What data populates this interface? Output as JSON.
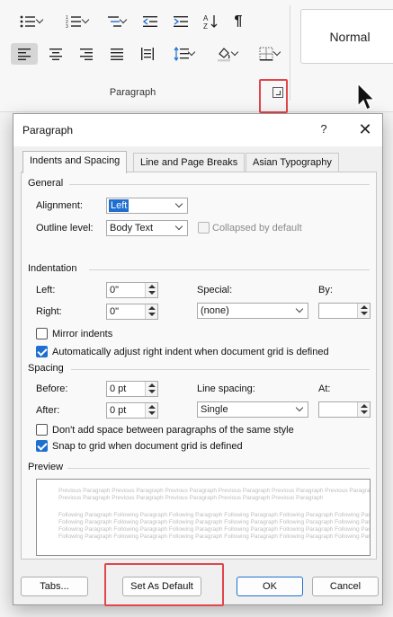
{
  "ribbon": {
    "group_label": "Paragraph",
    "style_name": "Normal",
    "icons_row1": [
      "bullets-icon",
      "numbering-icon",
      "multilevel-list-icon",
      "decrease-indent-icon",
      "increase-indent-icon",
      "sort-icon",
      "pilcrow-icon"
    ],
    "icons_row2": [
      "align-left-icon",
      "center-icon",
      "align-right-icon",
      "justify-icon",
      "column-distribute-icon",
      "line-spacing-icon",
      "shading-icon",
      "borders-icon"
    ],
    "accent_highlight": "#e0464b"
  },
  "dialog": {
    "title": "Paragraph",
    "help": "?",
    "close": "✕",
    "tabs": [
      "Indents and Spacing",
      "Line and Page Breaks",
      "Asian Typography"
    ],
    "active_tab": "Indents and Spacing",
    "general": {
      "heading": "General",
      "alignment_label": "Alignment:",
      "alignment_value": "Left",
      "outline_label": "Outline level:",
      "outline_value": "Body Text",
      "collapsed_label": "Collapsed by default"
    },
    "indentation": {
      "heading": "Indentation",
      "left_label": "Left:",
      "left_value": "0\"",
      "right_label": "Right:",
      "right_value": "0\"",
      "special_label": "Special:",
      "special_value": "(none)",
      "by_label": "By:",
      "by_value": "",
      "mirror_label": "Mirror indents",
      "mirror_checked": false,
      "auto_adjust_label": "Automatically adjust right indent when document grid is defined",
      "auto_adjust_checked": true
    },
    "spacing": {
      "heading": "Spacing",
      "before_label": "Before:",
      "before_value": "0 pt",
      "after_label": "After:",
      "after_value": "0 pt",
      "line_spacing_label": "Line spacing:",
      "line_spacing_value": "Single",
      "at_label": "At:",
      "at_value": "",
      "dont_add_label": "Don't add space between paragraphs of the same style",
      "dont_add_checked": false,
      "snap_label": "Snap to grid when document grid is defined",
      "snap_checked": true
    },
    "preview": {
      "heading": "Preview",
      "lines": [
        "Previous Paragraph Previous Paragraph Previous Paragraph Previous Paragraph Previous Paragraph Previous Paragraph",
        "Previous Paragraph Previous Paragraph Previous Paragraph Previous Paragraph Previous Paragraph",
        "Following Paragraph Following Paragraph Following Paragraph Following Paragraph Following Paragraph Following Paragraph",
        "Following Paragraph Following Paragraph Following Paragraph Following Paragraph Following Paragraph Following Paragraph",
        "Following Paragraph Following Paragraph Following Paragraph Following Paragraph Following Paragraph Following Paragraph",
        "Following Paragraph Following Paragraph Following Paragraph Following Paragraph Following Paragraph Following Paragraph"
      ]
    },
    "buttons": {
      "tabs": "Tabs...",
      "set_default": "Set As Default",
      "ok": "OK",
      "cancel": "Cancel"
    }
  }
}
